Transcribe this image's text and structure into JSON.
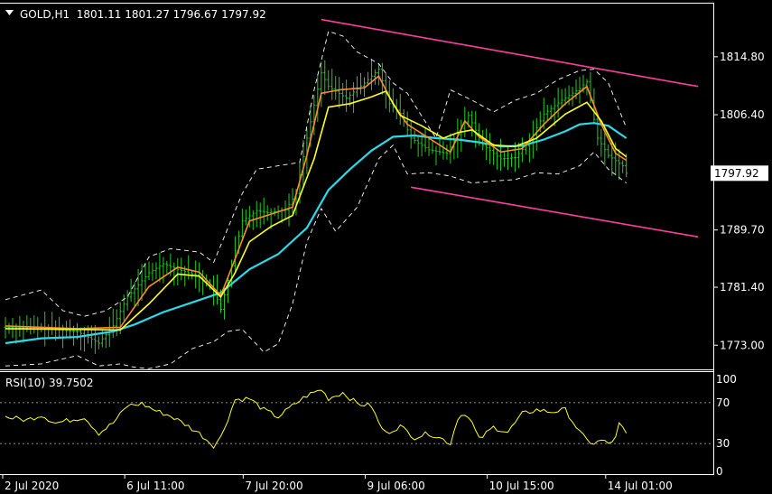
{
  "header": {
    "title": "GOLD,H1  1801.11 1801.27 1796.67 1797.92",
    "menu_icon": "triangle-down-icon"
  },
  "indicator": {
    "label": "RSI(10) 39.7502"
  },
  "colors": {
    "background": "#000000",
    "price_bars": "#22cc22",
    "ma_fast": "#ff8c2a",
    "ma_mid": "#ffff22",
    "ma_slow": "#2fd8e8",
    "bollinger": "#ffffff",
    "channel": "#ff3fa0",
    "rsi": "#ffff22",
    "axis_text": "#ffffff",
    "price_box_bg": "#ffffff",
    "price_box_text": "#000000"
  },
  "chart_data": [
    {
      "type": "line",
      "title": "GOLD,H1",
      "subtitle": "1801.11 1801.27 1796.67 1797.92",
      "ylim": [
        1769.5,
        1822.5
      ],
      "yticks": [
        1814.8,
        1806.4,
        1789.7,
        1781.4,
        1773.0
      ],
      "ytick_labels": [
        "1814.80",
        "1806.40",
        "1789.70",
        "1781.40",
        "1773.00"
      ],
      "current_price": 1797.92,
      "current_price_label": "1797.92",
      "xtick_labels": [
        "2 Jul 2020",
        "6 Jul 11:00",
        "7 Jul 20:00",
        "9 Jul 06:00",
        "10 Jul 15:00",
        "14 Jul 01:00"
      ],
      "xtick_bars": [
        0,
        34,
        67,
        101,
        135,
        168
      ],
      "bar_count": 174,
      "series": [
        {
          "role": "price_bars",
          "points": [
            [
              0,
              1775.6
            ],
            [
              10,
              1775.4
            ],
            [
              20,
              1775.0
            ],
            [
              26,
              1773.3
            ],
            [
              30,
              1775.8
            ],
            [
              34,
              1780.0
            ],
            [
              40,
              1783.5
            ],
            [
              44,
              1784.8
            ],
            [
              48,
              1784.0
            ],
            [
              54,
              1783.0
            ],
            [
              58,
              1781.0
            ],
            [
              60,
              1778.2
            ],
            [
              63,
              1784.5
            ],
            [
              66,
              1791.0
            ],
            [
              70,
              1792.5
            ],
            [
              73,
              1792.2
            ],
            [
              78,
              1792.6
            ],
            [
              81,
              1795.0
            ],
            [
              84,
              1803.0
            ],
            [
              88,
              1812.5
            ],
            [
              90,
              1810.5
            ],
            [
              95,
              1808.8
            ],
            [
              100,
              1811.0
            ],
            [
              104,
              1813.0
            ],
            [
              107,
              1808.0
            ],
            [
              110,
              1806.6
            ],
            [
              113,
              1803.0
            ],
            [
              118,
              1801.3
            ],
            [
              123,
              1800.8
            ],
            [
              126,
              1803.5
            ],
            [
              129,
              1806.3
            ],
            [
              133,
              1802.0
            ],
            [
              138,
              1800.0
            ],
            [
              142,
              1800.2
            ],
            [
              146,
              1802.5
            ],
            [
              150,
              1806.5
            ],
            [
              155,
              1808.5
            ],
            [
              160,
              1810.2
            ],
            [
              162,
              1811.2
            ],
            [
              165,
              1803.0
            ],
            [
              168,
              1800.5
            ],
            [
              172,
              1799.0
            ],
            [
              173,
              1797.9
            ]
          ]
        },
        {
          "role": "ma_fast",
          "points": [
            [
              0,
              1775.8
            ],
            [
              20,
              1775.4
            ],
            [
              32,
              1775.6
            ],
            [
              40,
              1781.5
            ],
            [
              48,
              1784.3
            ],
            [
              54,
              1783.6
            ],
            [
              60,
              1780.2
            ],
            [
              64,
              1785.5
            ],
            [
              68,
              1791.0
            ],
            [
              74,
              1792.0
            ],
            [
              80,
              1793.0
            ],
            [
              84,
              1800.5
            ],
            [
              88,
              1809.5
            ],
            [
              93,
              1810.0
            ],
            [
              100,
              1810.3
            ],
            [
              104,
              1812.0
            ],
            [
              108,
              1808.0
            ],
            [
              112,
              1805.0
            ],
            [
              118,
              1803.0
            ],
            [
              124,
              1801.0
            ],
            [
              128,
              1805.5
            ],
            [
              132,
              1803.2
            ],
            [
              138,
              1801.0
            ],
            [
              144,
              1801.5
            ],
            [
              150,
              1805.0
            ],
            [
              156,
              1808.0
            ],
            [
              162,
              1810.5
            ],
            [
              166,
              1805.0
            ],
            [
              170,
              1800.8
            ],
            [
              173,
              1799.8
            ]
          ]
        },
        {
          "role": "ma_mid",
          "points": [
            [
              0,
              1775.4
            ],
            [
              20,
              1775.3
            ],
            [
              32,
              1775.2
            ],
            [
              40,
              1779.0
            ],
            [
              48,
              1783.3
            ],
            [
              54,
              1783.0
            ],
            [
              60,
              1780.0
            ],
            [
              64,
              1783.5
            ],
            [
              68,
              1788.0
            ],
            [
              74,
              1790.2
            ],
            [
              80,
              1791.8
            ],
            [
              86,
              1800.0
            ],
            [
              90,
              1807.5
            ],
            [
              96,
              1808.0
            ],
            [
              102,
              1809.0
            ],
            [
              106,
              1809.8
            ],
            [
              110,
              1806.3
            ],
            [
              116,
              1804.8
            ],
            [
              122,
              1803.0
            ],
            [
              126,
              1803.8
            ],
            [
              130,
              1804.2
            ],
            [
              136,
              1802.0
            ],
            [
              142,
              1801.8
            ],
            [
              148,
              1803.0
            ],
            [
              156,
              1806.5
            ],
            [
              162,
              1808.2
            ],
            [
              166,
              1805.5
            ],
            [
              170,
              1801.5
            ],
            [
              173,
              1800.3
            ]
          ]
        },
        {
          "role": "ma_slow",
          "points": [
            [
              0,
              1773.3
            ],
            [
              10,
              1774.0
            ],
            [
              20,
              1774.2
            ],
            [
              30,
              1775.0
            ],
            [
              36,
              1776.0
            ],
            [
              44,
              1777.8
            ],
            [
              52,
              1779.2
            ],
            [
              60,
              1780.6
            ],
            [
              68,
              1784.0
            ],
            [
              76,
              1786.2
            ],
            [
              84,
              1790.0
            ],
            [
              90,
              1795.5
            ],
            [
              96,
              1798.5
            ],
            [
              102,
              1801.2
            ],
            [
              108,
              1803.2
            ],
            [
              114,
              1803.4
            ],
            [
              120,
              1803.0
            ],
            [
              126,
              1802.8
            ],
            [
              132,
              1802.4
            ],
            [
              138,
              1801.8
            ],
            [
              144,
              1801.9
            ],
            [
              150,
              1802.8
            ],
            [
              156,
              1804.0
            ],
            [
              160,
              1805.0
            ],
            [
              164,
              1805.2
            ],
            [
              168,
              1804.8
            ],
            [
              173,
              1803.0
            ]
          ]
        },
        {
          "role": "bollinger_upper",
          "points": [
            [
              0,
              1779.6
            ],
            [
              10,
              1781.0
            ],
            [
              16,
              1778.0
            ],
            [
              22,
              1777.2
            ],
            [
              28,
              1778.0
            ],
            [
              34,
              1780.0
            ],
            [
              40,
              1785.8
            ],
            [
              46,
              1787.0
            ],
            [
              54,
              1786.5
            ],
            [
              58,
              1785.0
            ],
            [
              62,
              1790.0
            ],
            [
              66,
              1795.0
            ],
            [
              70,
              1798.5
            ],
            [
              76,
              1799.0
            ],
            [
              82,
              1799.5
            ],
            [
              86,
              1810.0
            ],
            [
              90,
              1818.5
            ],
            [
              94,
              1817.8
            ],
            [
              98,
              1815.5
            ],
            [
              104,
              1813.8
            ],
            [
              108,
              1811.0
            ],
            [
              112,
              1809.5
            ],
            [
              116,
              1806.2
            ],
            [
              120,
              1803.0
            ],
            [
              124,
              1810.0
            ],
            [
              130,
              1808.5
            ],
            [
              136,
              1806.8
            ],
            [
              142,
              1808.5
            ],
            [
              148,
              1809.5
            ],
            [
              154,
              1811.5
            ],
            [
              160,
              1812.8
            ],
            [
              164,
              1813.0
            ],
            [
              168,
              1811.0
            ],
            [
              173,
              1804.5
            ]
          ]
        },
        {
          "role": "bollinger_lower",
          "points": [
            [
              0,
              1770.0
            ],
            [
              10,
              1770.3
            ],
            [
              20,
              1771.5
            ],
            [
              26,
              1770.0
            ],
            [
              32,
              1770.3
            ],
            [
              36,
              1769.8
            ],
            [
              40,
              1769.6
            ],
            [
              46,
              1770.3
            ],
            [
              52,
              1772.5
            ],
            [
              58,
              1773.5
            ],
            [
              62,
              1775.0
            ],
            [
              66,
              1775.3
            ],
            [
              72,
              1772.0
            ],
            [
              76,
              1773.2
            ],
            [
              80,
              1779.0
            ],
            [
              84,
              1788.0
            ],
            [
              88,
              1792.8
            ],
            [
              92,
              1789.5
            ],
            [
              98,
              1793.0
            ],
            [
              104,
              1800.0
            ],
            [
              108,
              1802.0
            ],
            [
              112,
              1797.8
            ],
            [
              118,
              1798.0
            ],
            [
              124,
              1797.5
            ],
            [
              130,
              1796.5
            ],
            [
              136,
              1796.8
            ],
            [
              142,
              1797.0
            ],
            [
              148,
              1798.0
            ],
            [
              154,
              1797.8
            ],
            [
              160,
              1799.0
            ],
            [
              164,
              1801.0
            ],
            [
              168,
              1798.5
            ],
            [
              173,
              1796.5
            ]
          ]
        },
        {
          "role": "channel_upper",
          "points": [
            [
              88,
              1820.2
            ],
            [
              193,
              1810.5
            ]
          ]
        },
        {
          "role": "channel_lower",
          "points": [
            [
              113,
              1795.9
            ],
            [
              193,
              1788.7
            ]
          ]
        }
      ]
    },
    {
      "type": "line",
      "title": "RSI(10) 39.7502",
      "ylim": [
        0,
        100
      ],
      "yticks": [
        100,
        70,
        30,
        0
      ],
      "ytick_labels": [
        "100",
        "70",
        "30",
        "0"
      ],
      "levels": [
        70,
        30
      ],
      "series": [
        {
          "role": "rsi",
          "points": [
            [
              0,
              56
            ],
            [
              6,
              53
            ],
            [
              10,
              58
            ],
            [
              14,
              50
            ],
            [
              18,
              53
            ],
            [
              22,
              56
            ],
            [
              26,
              40
            ],
            [
              30,
              50
            ],
            [
              34,
              67
            ],
            [
              38,
              69
            ],
            [
              42,
              62
            ],
            [
              46,
              57
            ],
            [
              50,
              49
            ],
            [
              54,
              40
            ],
            [
              58,
              28
            ],
            [
              60,
              36
            ],
            [
              64,
              73
            ],
            [
              68,
              74
            ],
            [
              72,
              63
            ],
            [
              76,
              56
            ],
            [
              80,
              67
            ],
            [
              84,
              77
            ],
            [
              88,
              83
            ],
            [
              90,
              74
            ],
            [
              94,
              80
            ],
            [
              98,
              69
            ],
            [
              102,
              67
            ],
            [
              104,
              50
            ],
            [
              106,
              40
            ],
            [
              110,
              47
            ],
            [
              114,
              36
            ],
            [
              118,
              40
            ],
            [
              122,
              34
            ],
            [
              124,
              30
            ],
            [
              126,
              55
            ],
            [
              128,
              60
            ],
            [
              130,
              50
            ],
            [
              132,
              34
            ],
            [
              136,
              46
            ],
            [
              140,
              41
            ],
            [
              144,
              59
            ],
            [
              148,
              63
            ],
            [
              152,
              61
            ],
            [
              156,
              63
            ],
            [
              158,
              52
            ],
            [
              160,
              41
            ],
            [
              162,
              33
            ],
            [
              164,
              30
            ],
            [
              166,
              33
            ],
            [
              168,
              30
            ],
            [
              170,
              35
            ],
            [
              171,
              49
            ],
            [
              173,
              40
            ]
          ]
        }
      ]
    }
  ]
}
